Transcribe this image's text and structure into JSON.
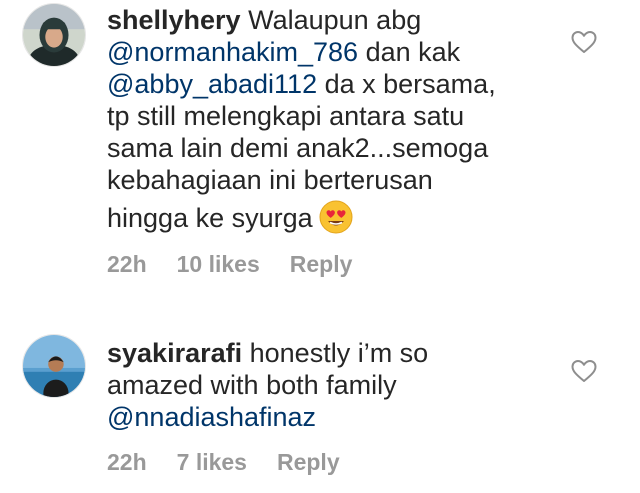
{
  "comments": [
    {
      "username": "shellyhery",
      "lines": {
        "l1_text": "Walaupun abg",
        "l2_mention": "@normanhakim_786",
        "l2_text": "dan kak",
        "l3_mention": "@abby_abadi112",
        "l3_text": "da x bersama,",
        "l4_text": "tp still melengkapi antara satu",
        "l5_text": "sama lain demi anak2...semoga",
        "l6_text": "kebahagiaan ini berterusan",
        "l7_text": "hingga ke syurga"
      },
      "emoji": "heart-eyes-emoji",
      "time": "22h",
      "likes": "10 likes",
      "reply": "Reply",
      "avatar_icon": "avatar-woman-hijab"
    },
    {
      "username": "syakirarafi",
      "lines": {
        "l1_text": "honestly i’m so",
        "l2_text": "amazed with both family",
        "l3_mention": "@nnadiashafinaz"
      },
      "time": "22h",
      "likes": "7 likes",
      "reply": "Reply",
      "avatar_icon": "avatar-person-sea"
    }
  ],
  "colors": {
    "text": "#262626",
    "mention": "#003569",
    "meta": "#999999",
    "heart_outline": "#8e8e8e"
  },
  "icons": {
    "like": "heart-outline-icon"
  }
}
